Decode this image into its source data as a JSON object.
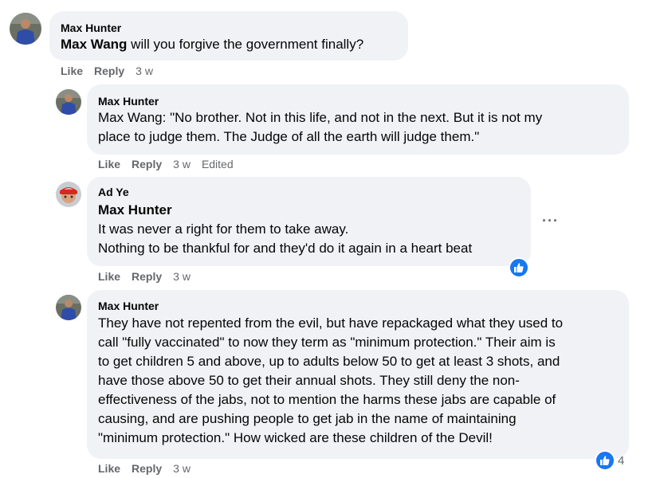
{
  "comments": [
    {
      "author": "Max Hunter",
      "mention": "Max Wang",
      "lines": [
        "will you forgive the government finally?"
      ],
      "actions": {
        "like": "Like",
        "reply": "Reply",
        "time": "3 w"
      }
    },
    {
      "author": "Max Hunter",
      "lines": [
        "Max Wang: \"No brother. Not in this life, and not in the next. But it is not my",
        "place to judge them. The Judge of all the earth will judge them.\""
      ],
      "actions": {
        "like": "Like",
        "reply": "Reply",
        "time": "3 w",
        "edited": "Edited"
      }
    },
    {
      "author": "Ad Ye",
      "mention": "Max Hunter",
      "lines": [
        "It was never a right for them to take away.",
        "Nothing to be thankful for and they'd do it again in a heart beat"
      ],
      "actions": {
        "like": "Like",
        "reply": "Reply",
        "time": "3 w"
      },
      "more_menu": "···"
    },
    {
      "author": "Max Hunter",
      "lines": [
        "They have not repented from the evil, but have repackaged what they used to",
        "call \"fully vaccinated\" to now they term as \"minimum protection.\" Their aim is",
        "to get children 5 and above, up to adults below 50 to get at least 3 shots, and",
        "have those above 50 to get their annual shots. They still deny the non-",
        "effectiveness of the jabs, not to mention the harms these jabs are capable of",
        "causing, and are pushing people to get jab in the name of maintaining",
        "\"minimum protection.\" How wicked are these children of the Devil!"
      ],
      "actions": {
        "like": "Like",
        "reply": "Reply",
        "time": "3 w"
      },
      "reaction_count": "4"
    }
  ],
  "colors": {
    "bubble": "#f0f2f5",
    "meta": "#65676b",
    "like_blue": "#1877f2"
  }
}
